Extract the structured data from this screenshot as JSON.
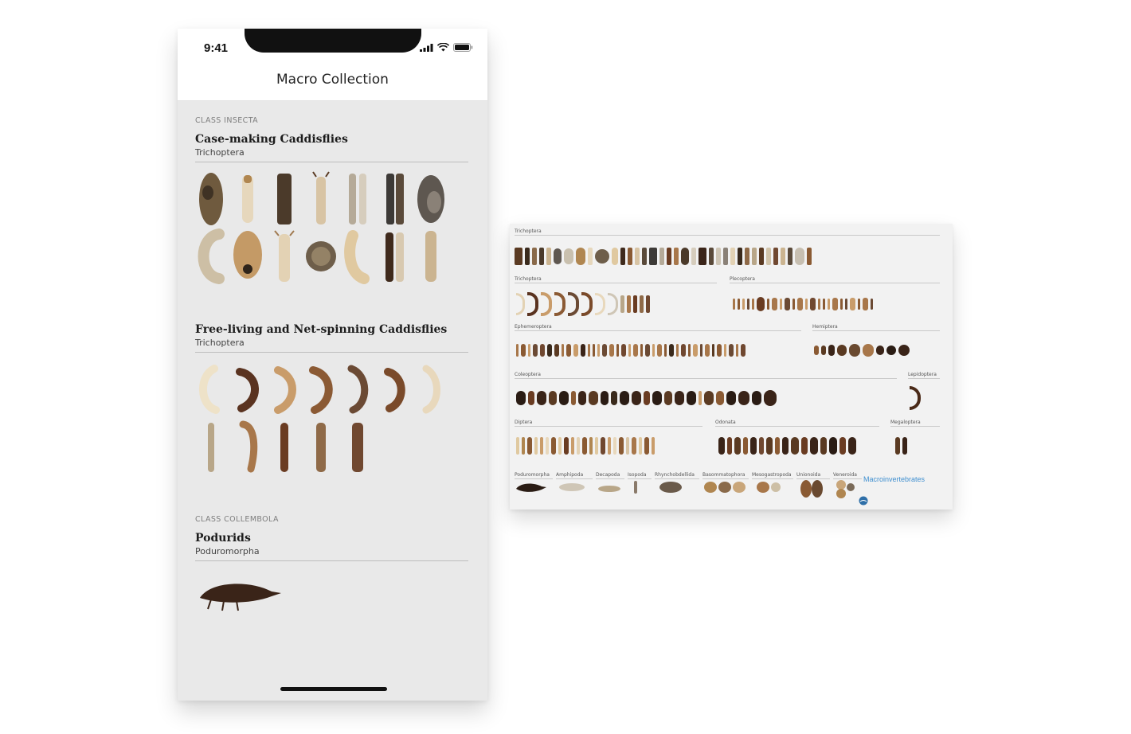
{
  "status_bar": {
    "time": "9:41"
  },
  "nav": {
    "title": "Macro Collection"
  },
  "sections": [
    {
      "class_label": "CLASS INSECTA",
      "title": "Case-making Caddisflies",
      "subtitle": "Trichoptera"
    },
    {
      "title": "Free-living and Net-spinning Caddisflies",
      "subtitle": "Trichoptera"
    },
    {
      "class_label": "CLASS COLLEMBOLA",
      "title": "Podurids",
      "subtitle": "Poduromorpha"
    }
  ],
  "poster": {
    "rows": [
      {
        "groups": [
          "Trichoptera"
        ]
      },
      {
        "groups": [
          "Trichoptera",
          "Plecoptera"
        ]
      },
      {
        "groups": [
          "Ephemeroptera",
          "Hemiptera"
        ]
      },
      {
        "groups": [
          "Coleoptera",
          "Lepidoptera"
        ]
      },
      {
        "groups": [
          "Diptera",
          "Odonata",
          "Megaloptera"
        ]
      }
    ],
    "bottom_groups": [
      "Poduromorpha",
      "Amphipoda",
      "Decapoda",
      "Isopoda",
      "Rhynchobdellida",
      "Basommatophora",
      "Mesogastropoda",
      "Unionoida",
      "Veneroida"
    ],
    "brand": "Macroinvertebrates"
  },
  "colors": {
    "specimen_dark": "#5a3a22",
    "specimen_mid": "#8a5a33",
    "specimen_light": "#d9c2a0",
    "brand_blue": "#3f8fd0"
  }
}
